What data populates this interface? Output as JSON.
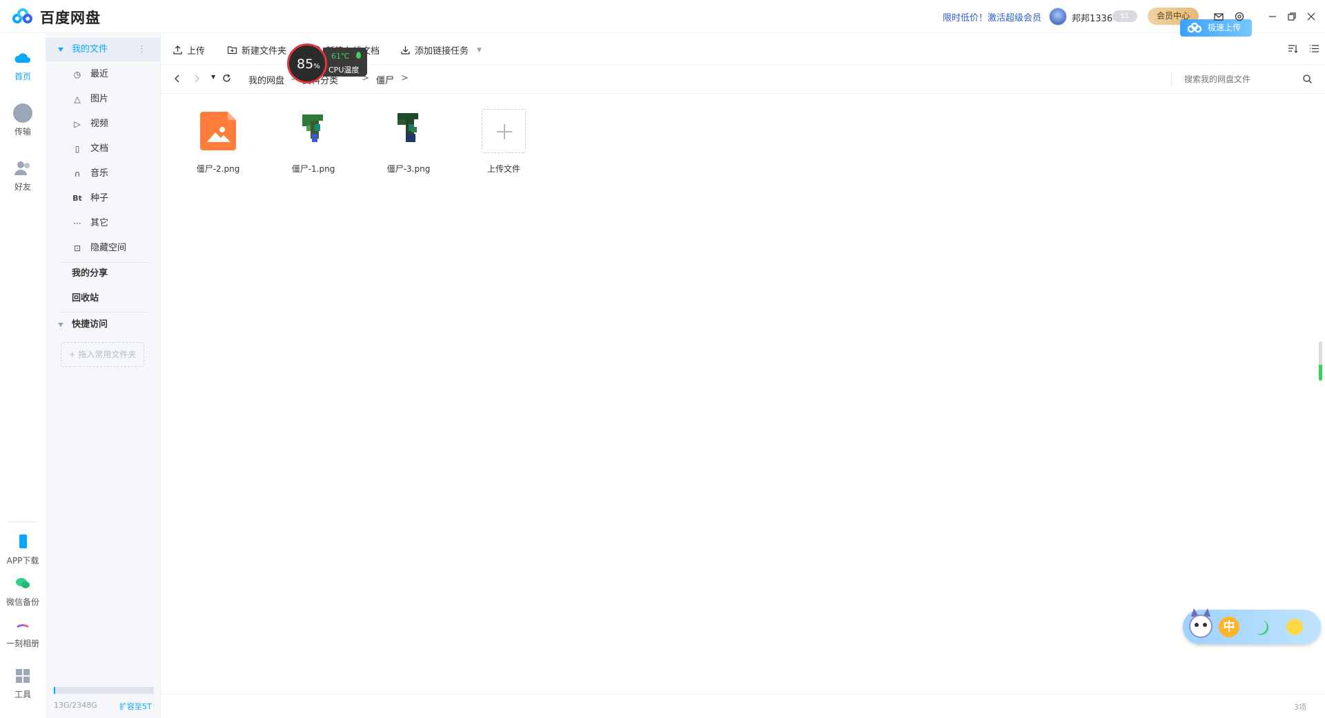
{
  "app": {
    "title": "百度网盘",
    "promo": "限时低价！激活超级会员",
    "username": "邦邦1336",
    "coin_level": "1",
    "vip_button": "会员中心",
    "upload_badge": "极速上传"
  },
  "rail": [
    {
      "label": "首页",
      "icon": "cloud-icon",
      "active": true
    },
    {
      "label": "传输",
      "icon": "transfer-icon"
    },
    {
      "label": "好友",
      "icon": "friends-icon"
    },
    {
      "label": "APP下载",
      "icon": "phone-icon"
    },
    {
      "label": "微信备份",
      "icon": "wechat-icon"
    },
    {
      "label": "一刻相册",
      "icon": "album-icon"
    },
    {
      "label": "工具",
      "icon": "tools-icon"
    }
  ],
  "sidebar": {
    "my_files": "我的文件",
    "items": [
      {
        "label": "最近",
        "icon": "clock-icon",
        "glyph": "◷"
      },
      {
        "label": "图片",
        "icon": "picture-icon",
        "glyph": "△"
      },
      {
        "label": "视频",
        "icon": "video-icon",
        "glyph": "▷"
      },
      {
        "label": "文档",
        "icon": "document-icon",
        "glyph": "▯"
      },
      {
        "label": "音乐",
        "icon": "headphone-icon",
        "glyph": "∩"
      },
      {
        "label": "种子",
        "icon": "bt-icon",
        "glyph": "Bt"
      },
      {
        "label": "其它",
        "icon": "more-icon",
        "glyph": "···"
      },
      {
        "label": "隐藏空间",
        "icon": "lock-icon",
        "glyph": "⊡"
      }
    ],
    "my_share": "我的分享",
    "recycle": "回收站",
    "quick_access": "快捷访问",
    "drop_hint": "+ 拖入常用文件夹",
    "quota": "13G/2348G",
    "quota_used_fraction": 0.0055,
    "expand": "扩容至5T"
  },
  "toolbar": {
    "upload": "上传",
    "new_folder": "新建文件夹",
    "new_online_doc": "新建在线文档",
    "add_link_task": "添加链接任务"
  },
  "breadcrumb": {
    "root": "我的网盘",
    "middle": "资料分类",
    "current": "僵尸",
    "separator": ">"
  },
  "search": {
    "placeholder": "搜索我的网盘文件"
  },
  "files": [
    {
      "name": "僵尸-2.png",
      "type": "image-placeholder"
    },
    {
      "name": "僵尸-1.png",
      "type": "thumbnail"
    },
    {
      "name": "僵尸-3.png",
      "type": "thumbnail"
    }
  ],
  "upload_file": "上传文件",
  "status": {
    "count": "3项"
  },
  "cpu_widget": {
    "percent": "85",
    "percent_unit": "%",
    "temp": "61℃",
    "label": "CPU温度"
  },
  "ime_widget": {
    "mode": "中"
  },
  "colors": {
    "accent": "#06a7ff",
    "promo": "#2e5cd6",
    "sidebar_bg": "#f5f7fa",
    "file_orange": "#ff7c3b"
  }
}
